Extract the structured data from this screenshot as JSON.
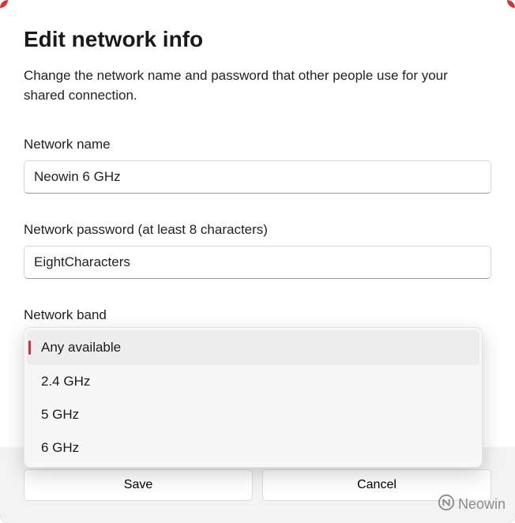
{
  "header": {
    "title": "Edit network info",
    "subtitle": "Change the network name and password that other people use for your shared connection."
  },
  "fields": {
    "network_name": {
      "label": "Network name",
      "value": "Neowin 6 GHz"
    },
    "network_password": {
      "label": "Network password (at least 8 characters)",
      "value": "EightCharacters"
    },
    "network_band": {
      "label": "Network band",
      "options": [
        {
          "label": "Any available",
          "selected": true
        },
        {
          "label": "2.4 GHz",
          "selected": false
        },
        {
          "label": "5 GHz",
          "selected": false
        },
        {
          "label": "6 GHz",
          "selected": false
        }
      ]
    }
  },
  "buttons": {
    "save": "Save",
    "cancel": "Cancel"
  },
  "watermark": {
    "text": "Neowin"
  }
}
